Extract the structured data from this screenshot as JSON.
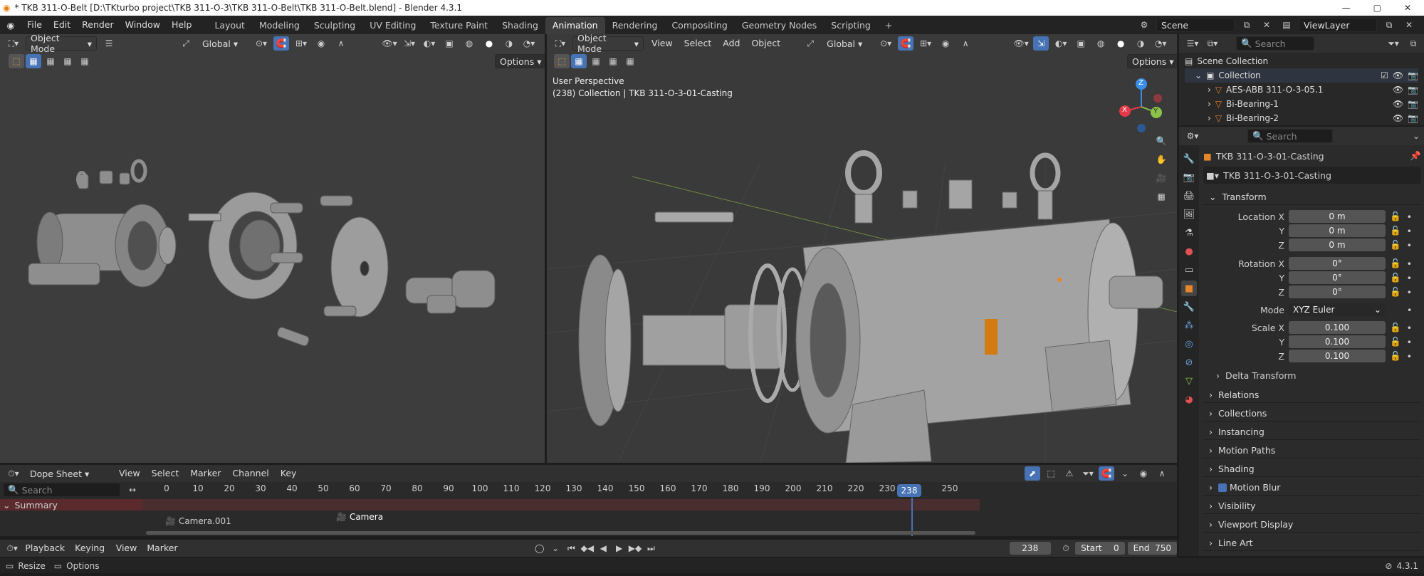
{
  "title": "* TKB 311-O-Belt [D:\\TKturbo project\\TKB 311-O-3\\TKB 311-O-Belt\\TKB 311-O-Belt.blend] - Blender 4.3.1",
  "menus": [
    "File",
    "Edit",
    "Render",
    "Window",
    "Help"
  ],
  "workspaces": [
    "Layout",
    "Modeling",
    "Sculpting",
    "UV Editing",
    "Texture Paint",
    "Shading",
    "Animation",
    "Rendering",
    "Compositing",
    "Geometry Nodes",
    "Scripting"
  ],
  "active_workspace": "Animation",
  "scene": "Scene",
  "view_layer": "ViewLayer",
  "left_vp": {
    "mode": "Object Mode",
    "orientation": "Global",
    "options": "Options"
  },
  "right_vp": {
    "mode": "Object Mode",
    "menu": [
      "View",
      "Select",
      "Add",
      "Object"
    ],
    "orientation": "Global",
    "options": "Options",
    "overlay_line1": "User Perspective",
    "overlay_line2": "(238) Collection | TKB 311-O-3-01-Casting"
  },
  "outliner": {
    "search": "Search",
    "scene_collection": "Scene Collection",
    "collection": "Collection",
    "items": [
      "AES-ABB 311-O-3-05.1",
      "Bi-Bearing-1",
      "Bi-Bearing-2"
    ]
  },
  "properties": {
    "search": "Search",
    "object_name": "TKB 311-O-3-01-Casting",
    "datablock": "TKB 311-O-3-01-Casting",
    "transform": "Transform",
    "location": {
      "label": "Location X",
      "x": "0 m",
      "y": "0 m",
      "z": "0 m"
    },
    "rotation": {
      "label": "Rotation X",
      "x": "0°",
      "y": "0°",
      "z": "0°"
    },
    "mode_label": "Mode",
    "mode_value": "XYZ Euler",
    "scale": {
      "label": "Scale X",
      "x": "0.100",
      "y": "0.100",
      "z": "0.100"
    },
    "axis_y": "Y",
    "axis_z": "Z",
    "delta": "Delta Transform",
    "panels": [
      "Relations",
      "Collections",
      "Instancing",
      "Motion Paths",
      "Shading",
      "Motion Blur",
      "Visibility",
      "Viewport Display",
      "Line Art"
    ]
  },
  "dopesheet": {
    "editor": "Dope Sheet",
    "menu": [
      "View",
      "Select",
      "Marker",
      "Channel",
      "Key"
    ],
    "search": "Search",
    "summary": "Summary",
    "ticks": [
      "0",
      "10",
      "20",
      "30",
      "40",
      "50",
      "60",
      "70",
      "80",
      "90",
      "100",
      "110",
      "120",
      "130",
      "140",
      "150",
      "160",
      "170",
      "180",
      "190",
      "200",
      "210",
      "220",
      "230",
      "238",
      "250"
    ],
    "markers": [
      "Camera.001",
      "Camera"
    ]
  },
  "playback": {
    "menu": [
      "Playback",
      "Keying",
      "View",
      "Marker"
    ],
    "current": "238",
    "start_label": "Start",
    "start": "0",
    "end_label": "End",
    "end": "750"
  },
  "status": {
    "resize": "Resize",
    "options": "Options",
    "version": "4.3.1"
  },
  "gizmo": {
    "x": "X",
    "y": "Y",
    "z": "Z"
  },
  "colors": {
    "accent": "#4772b3",
    "x_axis": "#e53a49",
    "y_axis": "#8bc34a",
    "z_axis": "#3a8ee5",
    "selected": "#e6862b"
  }
}
